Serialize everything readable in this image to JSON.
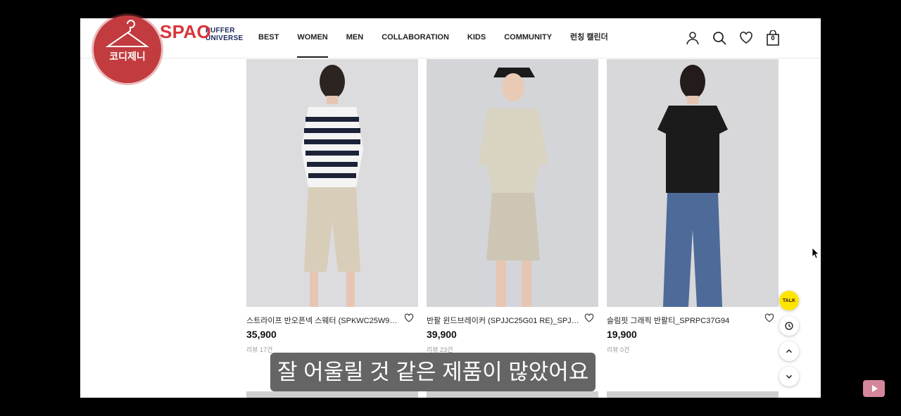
{
  "overlay": {
    "stamp_text": "코디제니",
    "subtitle": "잘 어울릴 것 같은 제품이 많았어요"
  },
  "header": {
    "logo_mark": "SPAO",
    "logo_text_line1": "PUFFER",
    "logo_text_line2": "UNIVERSE",
    "nav": [
      "BEST",
      "WOMEN",
      "MEN",
      "COLLABORATION",
      "KIDS",
      "COMMUNITY",
      "런칭 캘린더"
    ],
    "active_nav": "WOMEN",
    "cart_count": "0"
  },
  "products": [
    {
      "name": "스트라이프 반오픈넥 스웨터 (SPKWC25W92 R...",
      "price": "35,900",
      "review": "리뷰 17건"
    },
    {
      "name": "반팔 윈드브레이커 (SPJJC25G01 RE)_SPJJC3...",
      "price": "39,900",
      "review": "리뷰 23건"
    },
    {
      "name": "슬림핏 그래픽 반팔티_SPRPC37G94",
      "price": "19,900",
      "review": "리뷰 0건"
    }
  ],
  "floating": {
    "talk_label": "TALK"
  },
  "colors": {
    "stamp": "#c23b3f",
    "talk": "#fee500",
    "nav_text": "#222222"
  }
}
